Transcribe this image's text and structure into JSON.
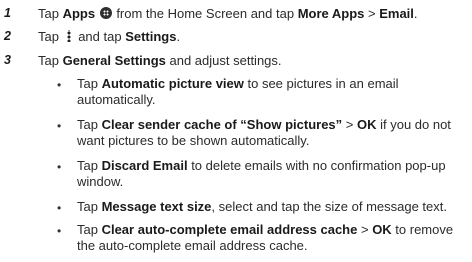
{
  "steps": [
    {
      "number": "1",
      "prefix": "Tap ",
      "apps": "Apps",
      "middle": " from the Home Screen and tap ",
      "more_apps": "More Apps",
      "sep": " > ",
      "email": "Email",
      "suffix": ".",
      "icon": "apps-grid-icon"
    },
    {
      "number": "2",
      "prefix": "Tap ",
      "middle": " and tap ",
      "settings": "Settings",
      "suffix": ".",
      "icon": "more-options-icon"
    },
    {
      "number": "3",
      "prefix": "Tap ",
      "general_settings": "General Settings",
      "suffix": " and adjust settings."
    }
  ],
  "bullets": [
    {
      "prefix": "Tap ",
      "bold": "Automatic picture view",
      "line1_rest": " to see pictures in an email",
      "line2": "automatically."
    },
    {
      "prefix": "Tap ",
      "bold": "Clear sender cache of “Show pictures”",
      "sep": " > ",
      "bold2": "OK",
      "line1_rest": " if you do not",
      "line2": "want pictures to be shown automatically."
    },
    {
      "prefix": "Tap ",
      "bold": "Discard Email",
      "line1_rest": " to delete emails with no confirmation pop-up",
      "line2": "window."
    },
    {
      "prefix": "Tap ",
      "bold": "Message text size",
      "line1_rest": ", select and tap the size of message text."
    },
    {
      "prefix": "Tap ",
      "bold": "Clear auto-complete email address cache",
      "sep": " > ",
      "bold2": "OK",
      "line1_rest": " to remove",
      "line2": "the auto-complete email address cache."
    }
  ],
  "bullet_glyph": "•"
}
